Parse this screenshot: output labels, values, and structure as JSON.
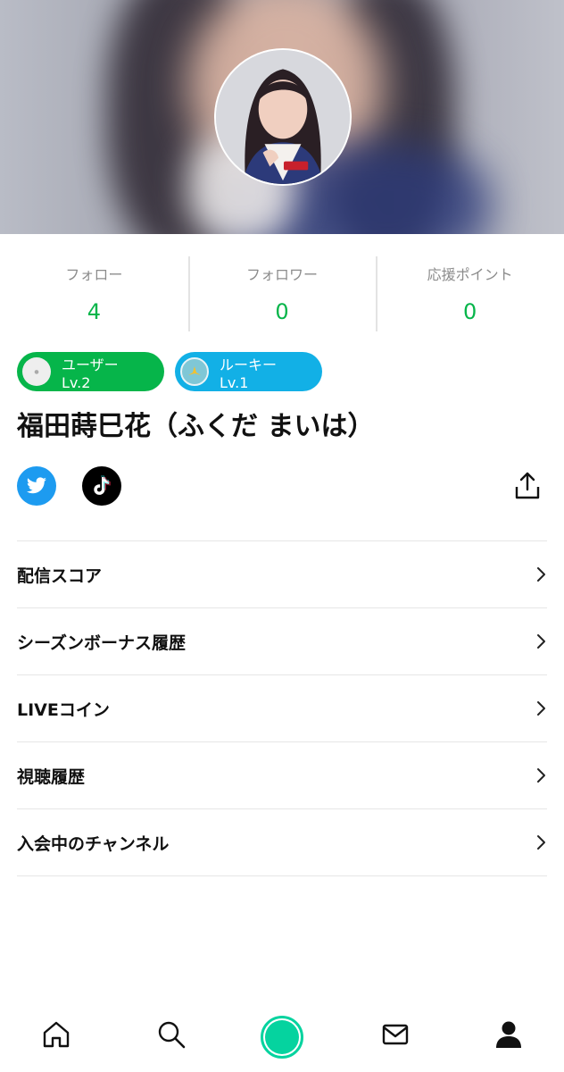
{
  "profile": {
    "name": "福田蒔巳花（ふくだ まいは）"
  },
  "stats": [
    {
      "label": "フォロー",
      "value": "4"
    },
    {
      "label": "フォロワー",
      "value": "0"
    },
    {
      "label": "応援ポイント",
      "value": "0"
    }
  ],
  "badges": [
    {
      "label": "ユーザー Lv.2",
      "color": "#06b54a",
      "icon": "user-level-icon"
    },
    {
      "label": "ルーキー Lv.1",
      "color": "#12b0e6",
      "icon": "rookie-level-icon"
    }
  ],
  "socials": [
    {
      "name": "twitter",
      "icon": "twitter-bird-icon",
      "color": "#1d9bf0"
    },
    {
      "name": "tiktok",
      "icon": "tiktok-note-icon",
      "color": "#000000"
    }
  ],
  "menu": [
    {
      "label": "配信スコア"
    },
    {
      "label": "シーズンボーナス履歴"
    },
    {
      "label": "LIVEコイン"
    },
    {
      "label": "視聴履歴"
    },
    {
      "label": "入会中のチャンネル"
    }
  ],
  "nav": {
    "items": [
      "home-icon",
      "search-icon",
      "live-icon",
      "mail-icon",
      "profile-icon"
    ],
    "accent": "#05d39f"
  }
}
